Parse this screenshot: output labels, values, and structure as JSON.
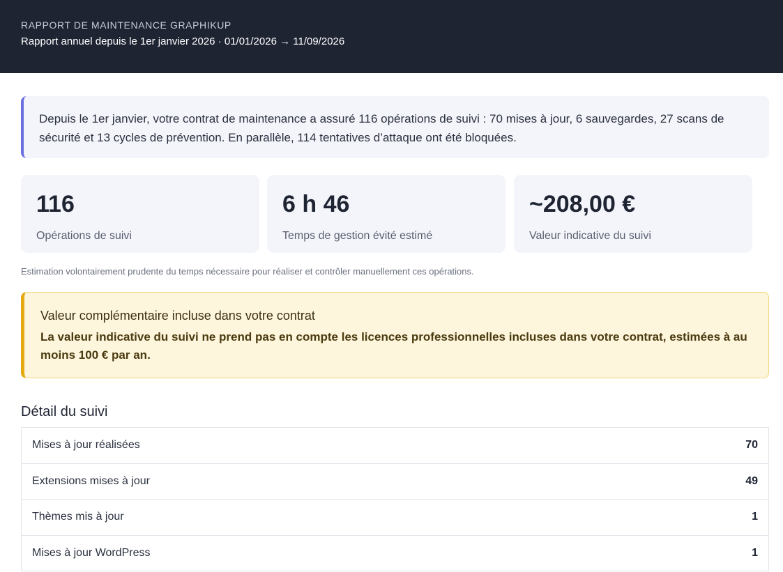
{
  "header": {
    "eyebrow": "RAPPORT DE MAINTENANCE GRAPHIKUP",
    "subtitle": "Rapport annuel depuis le 1er janvier 2026 · 01/01/2026 → 11/09/2026"
  },
  "summary": {
    "text": "Depuis le 1er janvier, votre contrat de maintenance a assuré 116 opérations de suivi : 70 mises à jour, 6 sauvegardes, 27 scans de sécurité et 13 cycles de prévention. En parallèle, 114 tentatives d’attaque ont été bloquées."
  },
  "stats": [
    {
      "value": "116",
      "label": "Opérations de suivi"
    },
    {
      "value": "6 h 46",
      "label": "Temps de gestion évité estimé"
    },
    {
      "value": "~208,00 €",
      "label": "Valeur indicative du suivi"
    }
  ],
  "estimate_note": "Estimation volontairement prudente du temps nécessaire pour réaliser et contrôler manuellement ces opérations.",
  "callout": {
    "title": "Valeur complémentaire incluse dans votre contrat",
    "body": "La valeur indicative du suivi ne prend pas en compte les licences professionnelles incluses dans votre contrat, estimées à au moins 100 € par an.",
    "accent_color": "#e6a912"
  },
  "detail": {
    "title": "Détail du suivi",
    "rows": [
      {
        "label": "Mises à jour réalisées",
        "value": "70"
      },
      {
        "label": "Extensions mises à jour",
        "value": "49"
      },
      {
        "label": "Thèmes mis à jour",
        "value": "1"
      },
      {
        "label": "Mises à jour WordPress",
        "value": "1"
      }
    ]
  },
  "colors": {
    "header_bg": "#1f2433",
    "summary_accent": "#6a6fe0",
    "card_bg": "#f4f5fa"
  }
}
